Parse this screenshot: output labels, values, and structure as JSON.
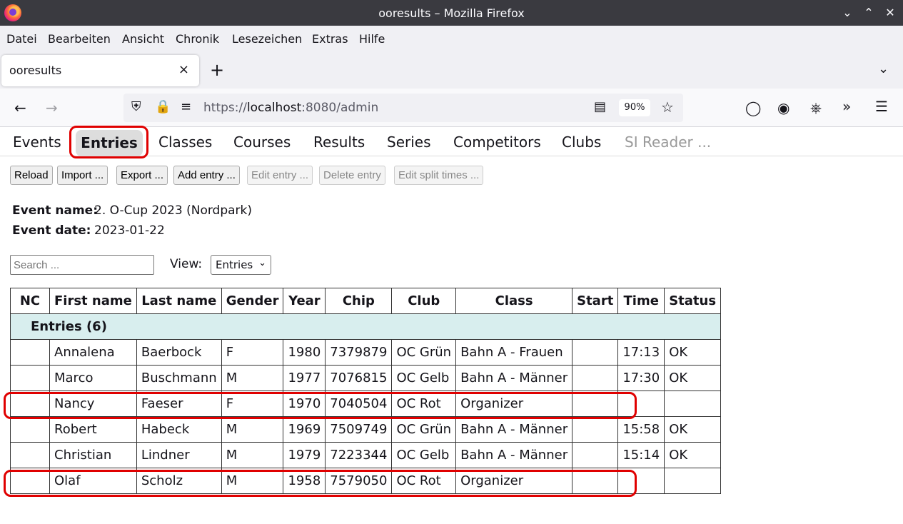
{
  "window": {
    "title": "ooresults – Mozilla Firefox"
  },
  "menu": [
    "Datei",
    "Bearbeiten",
    "Ansicht",
    "Chronik",
    "Lesezeichen",
    "Extras",
    "Hilfe"
  ],
  "tab": {
    "label": "ooresults",
    "close": "×",
    "new": "+"
  },
  "urlbar": {
    "url_prefix": "https://",
    "url_host": "localhost",
    "url_suffix": ":8080/admin",
    "zoom": "90%"
  },
  "nav": {
    "items": [
      "Events",
      "Entries",
      "Classes",
      "Courses",
      "Results",
      "Series",
      "Competitors",
      "Clubs",
      "SI Reader ..."
    ],
    "active": "Entries"
  },
  "actions": [
    "Reload",
    "Import ...",
    "Export ...",
    "Add entry ...",
    "Edit entry ...",
    "Delete entry",
    "Edit split times ..."
  ],
  "event": {
    "name_label": "Event name:",
    "name": "2. O-Cup 2023 (Nordpark)",
    "date_label": "Event date:",
    "date": "2023-01-22"
  },
  "search": {
    "placeholder": "Search ..."
  },
  "view": {
    "label": "View:",
    "selected": "Entries"
  },
  "table": {
    "headers": [
      "NC",
      "First name",
      "Last name",
      "Gender",
      "Year",
      "Chip",
      "Club",
      "Class",
      "Start",
      "Time",
      "Status"
    ],
    "group": "Entries  (6)",
    "rows": [
      [
        "",
        "Annalena",
        "Baerbock",
        "F",
        "1980",
        "7379879",
        "OC Grün",
        "Bahn A - Frauen",
        "",
        "17:13",
        "OK"
      ],
      [
        "",
        "Marco",
        "Buschmann",
        "M",
        "1977",
        "7076815",
        "OC Gelb",
        "Bahn A - Männer",
        "",
        "17:30",
        "OK"
      ],
      [
        "",
        "Nancy",
        "Faeser",
        "F",
        "1970",
        "7040504",
        "OC Rot",
        "Organizer",
        "",
        "",
        ""
      ],
      [
        "",
        "Robert",
        "Habeck",
        "M",
        "1969",
        "7509749",
        "OC Grün",
        "Bahn A - Männer",
        "",
        "15:58",
        "OK"
      ],
      [
        "",
        "Christian",
        "Lindner",
        "M",
        "1979",
        "7223344",
        "OC Gelb",
        "Bahn A - Männer",
        "",
        "15:14",
        "OK"
      ],
      [
        "",
        "Olaf",
        "Scholz",
        "M",
        "1958",
        "7579050",
        "OC Rot",
        "Organizer",
        "",
        "",
        ""
      ]
    ]
  },
  "highlight_color": "#e00000"
}
